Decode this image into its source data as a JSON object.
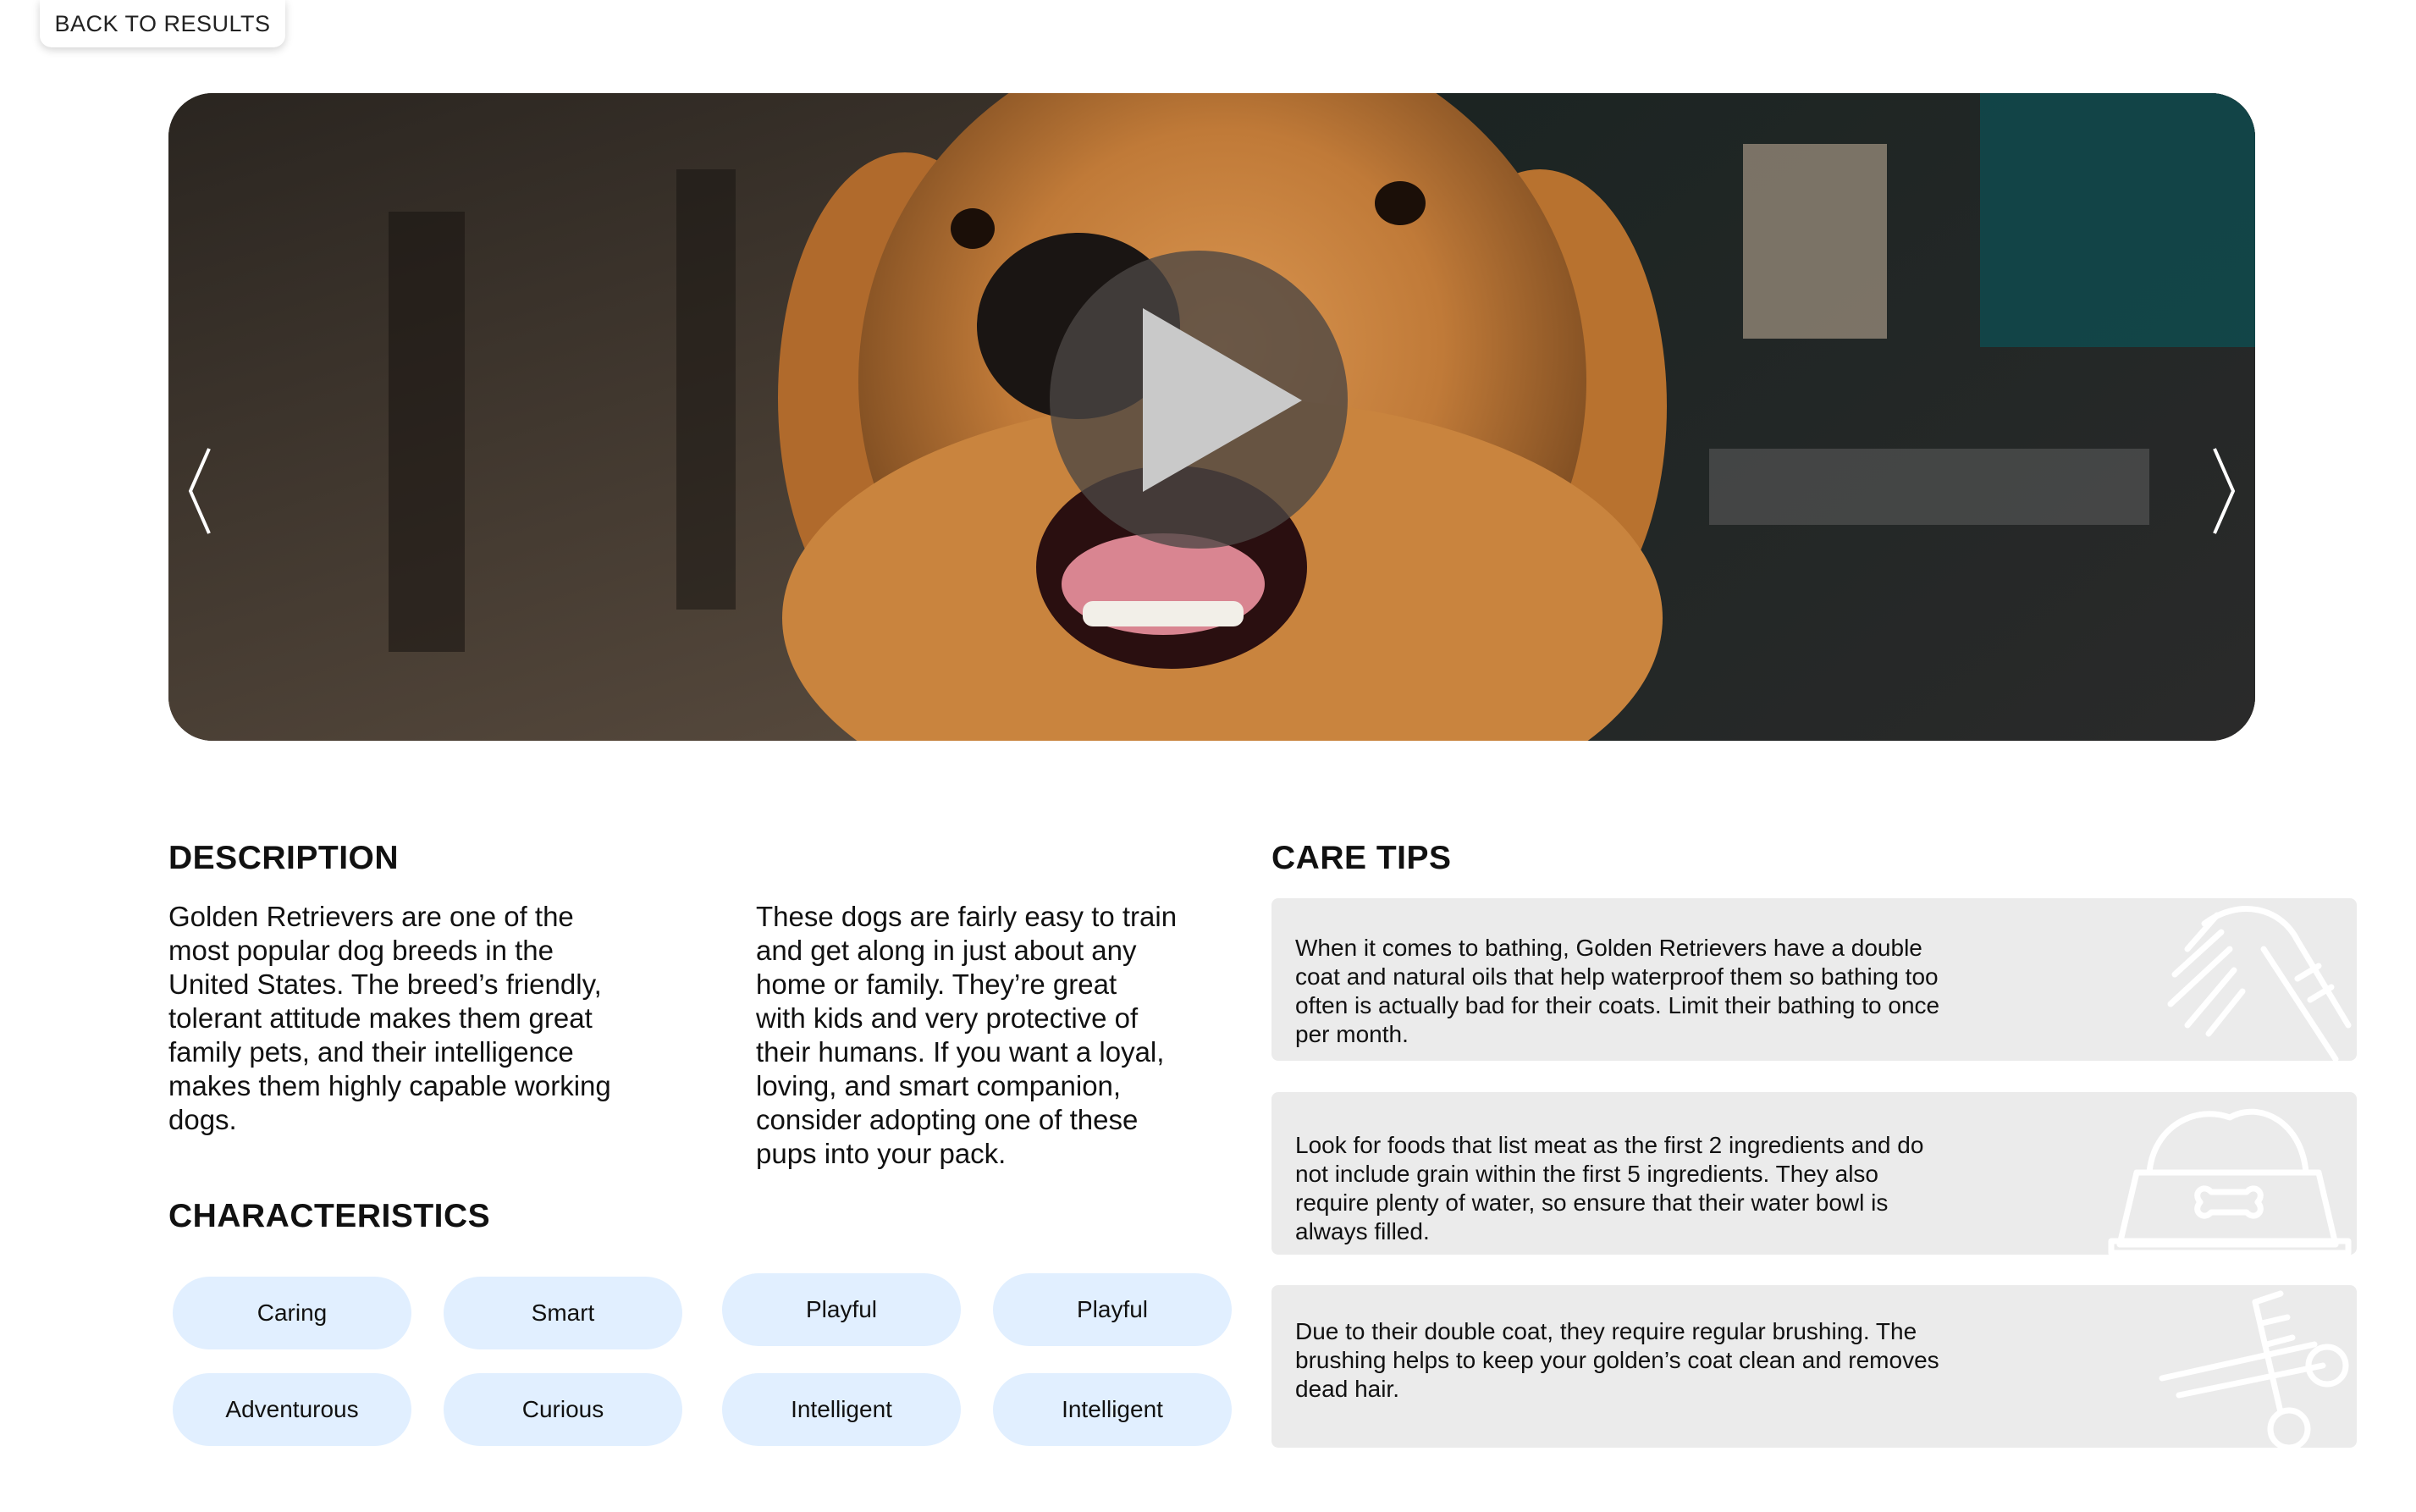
{
  "nav": {
    "back_label": "BACK TO RESULTS"
  },
  "carousel": {
    "slide_count": 5,
    "active_slide": 2
  },
  "description": {
    "heading": "DESCRIPTION",
    "col1_lines": [
      "Golden Retrievers are one of the",
      "most popular dog breeds in the",
      "United States. The breed’s friendly,",
      "tolerant attitude makes them great",
      "family pets, and their intelligence",
      "makes them highly capable working",
      "dogs."
    ],
    "col2_lines": [
      "These dogs are fairly easy to train",
      "and get along in just about any",
      "home or family. They’re great",
      "with kids and very protective of",
      "their humans. If you want a loyal,",
      "loving, and smart companion,",
      "consider adopting one of these",
      "pups into your pack."
    ]
  },
  "characteristics": {
    "heading": "CHARACTERISTICS",
    "chips": [
      "Caring",
      "Smart",
      "Playful",
      "Playful",
      "Adventurous",
      "Curious",
      "Intelligent",
      "Intelligent"
    ]
  },
  "care_tips": {
    "heading": "CARE TIPS",
    "tips": [
      {
        "icon": "shower-icon",
        "lines": [
          "When it comes to bathing, Golden Retrievers have a double",
          "coat and natural oils that help waterproof them so bathing too",
          "often is actually bad for their coats. Limit their bathing to once",
          "per month."
        ]
      },
      {
        "icon": "food-bowl-icon",
        "lines": [
          "Look for foods that list meat as the first 2 ingredients and do",
          "not include grain within the first 5 ingredients. They also",
          "require plenty of water, so ensure that their water bowl is",
          "always filled."
        ]
      },
      {
        "icon": "grooming-scissors-icon",
        "lines": [
          "Due to their double coat, they require regular brushing. The",
          "brushing helps to keep your golden’s coat clean and removes",
          "dead hair."
        ]
      }
    ]
  },
  "colors": {
    "chip_bg": "#e1efff",
    "tip_bg": "#ebebeb",
    "text": "#111111"
  }
}
